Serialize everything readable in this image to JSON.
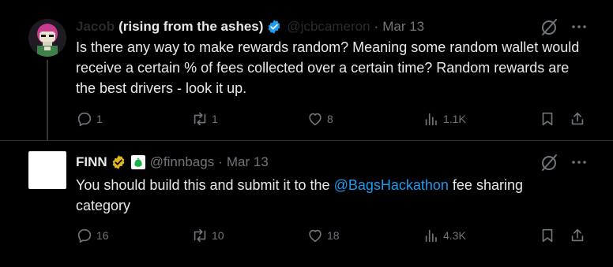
{
  "tweets": [
    {
      "author_name": "Jacob",
      "author_name_suffix": "(rising from the ashes)",
      "handle": "@jcbcameron",
      "date": "Mar 13",
      "verified": "blue-check",
      "text": "Is there any way to make rewards random? Meaning some random wallet would receive a certain % of fees collected over a certain time? Random rewards are the best drivers - look it up.",
      "replies": "1",
      "reposts": "1",
      "likes": "8",
      "views": "1.1K"
    },
    {
      "author_name": "FINN",
      "handle": "@finnbags",
      "date": "Mar 13",
      "verified": "gold-check",
      "affiliate_icon": "money-bag-icon",
      "text_before": "You should build this and submit it to the ",
      "mention": "@BagsHackathon",
      "text_after": " fee sharing category",
      "replies": "16",
      "reposts": "10",
      "likes": "18",
      "views": "4.3K"
    }
  ],
  "colors": {
    "background": "#000000",
    "text": "#e7e9ea",
    "muted": "#71767b",
    "link": "#1d9bf0",
    "verified_blue": "#1d9bf0",
    "verified_gold": "#e2b719"
  }
}
